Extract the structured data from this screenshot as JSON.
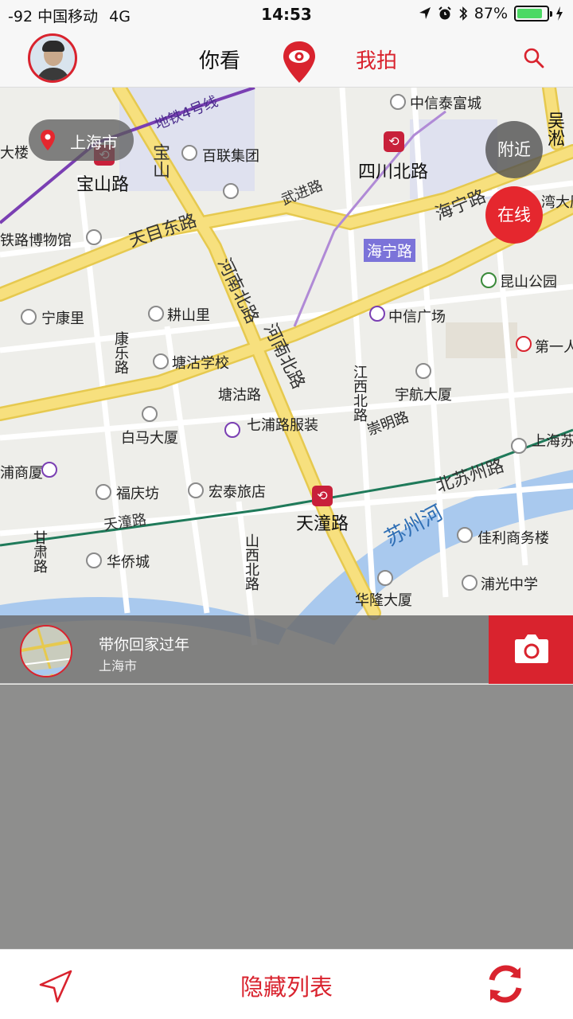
{
  "status_bar": {
    "signal": "-92",
    "carrier": "中国移动",
    "network": "4G",
    "time": "14:53",
    "battery": "87%",
    "battery_level": 0.87
  },
  "nav": {
    "tab_left": "你看",
    "tab_right": "我拍",
    "icons": [
      "avatar",
      "eye-pin-logo-icon",
      "search-icon"
    ]
  },
  "map": {
    "city": "上海市",
    "nearby": "附近",
    "online": "在线",
    "labels": {
      "metro_line": "地铁4号线",
      "zhongxin_tai": "中信泰富城",
      "wusong": "吴淞",
      "city_label_left": "大楼",
      "baolian": "百联集团",
      "sichuan_n_rd": "四川北路",
      "baoshan_rd": "宝山路",
      "baoshan_v": "宝山",
      "wujin_rd": "武进路",
      "haining_rd_h": "海宁路",
      "haining_rd_box": "海宁路",
      "wan_label": "湾大厦",
      "railway_museum": "铁路博物馆",
      "tianmu_e_rd": "天目东路",
      "kunshan_park": "昆山公园",
      "henan_n_rd_1": "河南北路",
      "henan_n_rd_2": "河南北路",
      "ningkang": "宁康里",
      "gengshan": "耕山里",
      "zhongxin_plaza": "中信广场",
      "first_people": "第一人",
      "kangle_rd": "康乐路",
      "tanggu_school": "塘沽学校",
      "jiangxi_n_rd": "江西北路",
      "yuhang": "宇航大厦",
      "tanggu_rd": "塘沽路",
      "chongming_rd": "崇明路",
      "baima": "白马大厦",
      "qipu_clothes": "七浦路服装",
      "shanghai_su": "上海苏",
      "pu_shang": "浦商厦",
      "n_suzhou_rd": "北苏州路",
      "fuqing": "福庆坊",
      "hongtai": "宏泰旅店",
      "tiantong_rd": "天潼路",
      "tiantong_station": "天潼路",
      "suzhou_river": "苏州河",
      "jiali": "佳利商务楼",
      "gansu_rd": "甘肃路",
      "huaqiao": "华侨城",
      "shanxi_n_rd": "山西北路",
      "puguang": "浦光中学",
      "hualong": "华隆大厦"
    }
  },
  "list": {
    "items": [
      {
        "title": "带你回家过年",
        "subtitle": "上海市"
      }
    ]
  },
  "bottom_bar": {
    "hide_list": "隐藏列表"
  },
  "colors": {
    "accent": "#d9232e",
    "road_major": "#f7e07e",
    "water": "#a9c9ee",
    "map_bg": "#eeeeea"
  }
}
